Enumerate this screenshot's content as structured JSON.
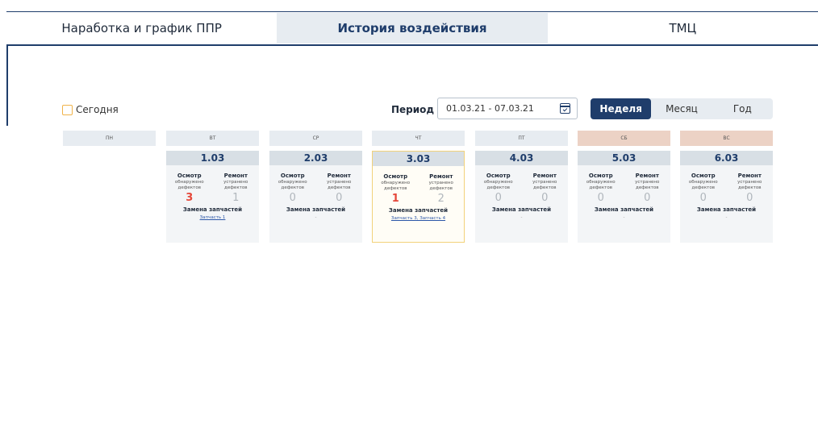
{
  "tabs": [
    {
      "label": "Наработка и график ППР",
      "active": false
    },
    {
      "label": "История воздействия",
      "active": true
    },
    {
      "label": "ТМЦ",
      "active": false
    }
  ],
  "today_label": "Сегодня",
  "period": {
    "label": "Период",
    "value": "01.03.21 - 07.03.21"
  },
  "range_options": [
    {
      "label": "Неделя",
      "active": true
    },
    {
      "label": "Месяц",
      "active": false
    },
    {
      "label": "Год",
      "active": false
    }
  ],
  "days": [
    {
      "name": "ПН",
      "weekend": false,
      "card": null
    },
    {
      "name": "ВТ",
      "weekend": false,
      "card": {
        "date": "1.03",
        "found": "3",
        "found_red": true,
        "fixed": "1",
        "fixed_red": false,
        "parts": "Запчасть 1"
      }
    },
    {
      "name": "СР",
      "weekend": false,
      "card": {
        "date": "2.03",
        "found": "0",
        "found_red": false,
        "fixed": "0",
        "fixed_red": false,
        "parts": "-"
      }
    },
    {
      "name": "ЧТ",
      "weekend": false,
      "card": {
        "date": "3.03",
        "found": "1",
        "found_red": true,
        "fixed": "2",
        "fixed_red": false,
        "parts": "Запчасть 3, Запчасть 4",
        "highlight": true
      }
    },
    {
      "name": "ПТ",
      "weekend": false,
      "card": {
        "date": "4.03",
        "found": "0",
        "found_red": false,
        "fixed": "0",
        "fixed_red": false,
        "parts": "-"
      }
    },
    {
      "name": "СБ",
      "weekend": true,
      "card": {
        "date": "5.03",
        "found": "0",
        "found_red": false,
        "fixed": "0",
        "fixed_red": false,
        "parts": "-"
      }
    },
    {
      "name": "ВС",
      "weekend": true,
      "card": {
        "date": "6.03",
        "found": "0",
        "found_red": false,
        "fixed": "0",
        "fixed_red": false,
        "parts": "-"
      }
    }
  ],
  "card_labels": {
    "inspect": "Осмотр",
    "inspect_sub": "обнаружено дефектов",
    "repair": "Ремонт",
    "repair_sub": "устранено дефектов",
    "parts_title": "Замена запчастей"
  },
  "colors": {
    "accent": "#1f3d6b",
    "defect_red": "#e5473a",
    "weekend": "#ecd2c5",
    "highlight_border": "#f2d27a"
  }
}
